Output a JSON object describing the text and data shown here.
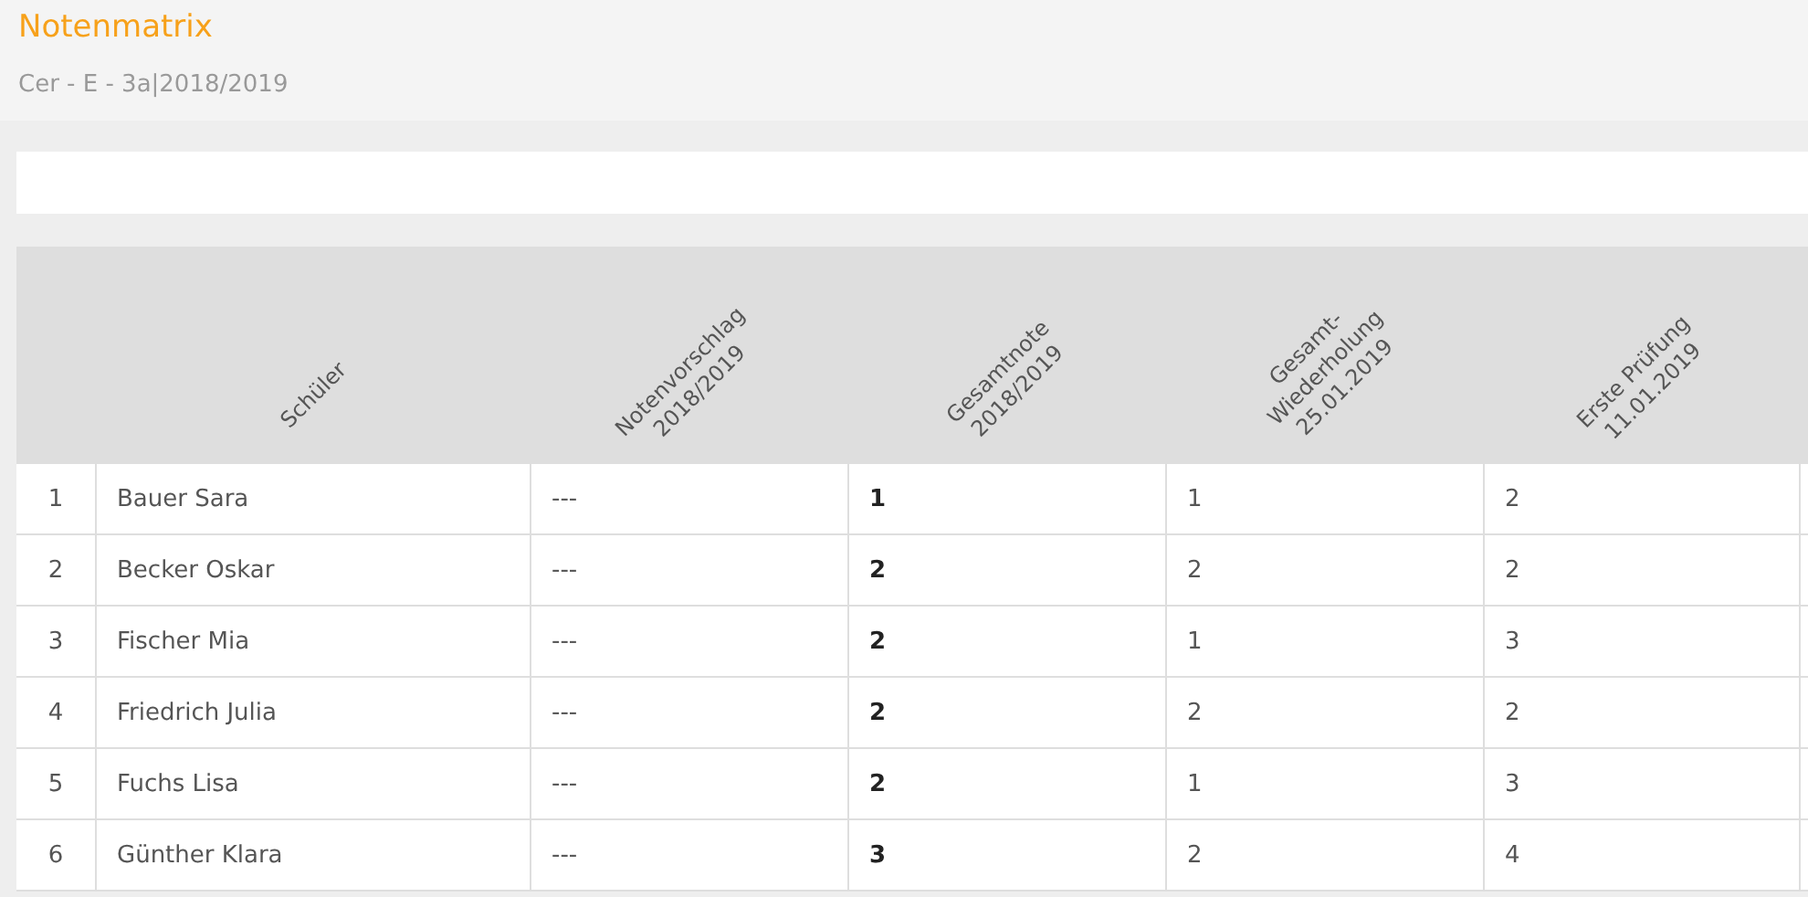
{
  "page": {
    "title": "Notenmatrix",
    "subtitle": "Cer - E - 3a|2018/2019"
  },
  "table": {
    "columns": [
      {
        "label": "Schüler"
      },
      {
        "label": "Notenvorschlag\n2018/2019"
      },
      {
        "label": "Gesamtnote\n2018/2019"
      },
      {
        "label": "Gesamt-Wiederholung\n25.01.2019"
      },
      {
        "label": "Erste Prüfung\n11.01.2019"
      }
    ],
    "rows": [
      {
        "number": "1",
        "cells": [
          "Bauer Sara",
          "---",
          "1",
          "1",
          "2"
        ]
      },
      {
        "number": "2",
        "cells": [
          "Becker Oskar",
          "---",
          "2",
          "2",
          "2"
        ]
      },
      {
        "number": "3",
        "cells": [
          "Fischer Mia",
          "---",
          "2",
          "1",
          "3"
        ]
      },
      {
        "number": "4",
        "cells": [
          "Friedrich Julia",
          "---",
          "2",
          "2",
          "2"
        ]
      },
      {
        "number": "5",
        "cells": [
          "Fuchs Lisa",
          "---",
          "2",
          "1",
          "3"
        ]
      },
      {
        "number": "6",
        "cells": [
          "Günther Klara",
          "---",
          "3",
          "2",
          "4"
        ]
      }
    ]
  }
}
